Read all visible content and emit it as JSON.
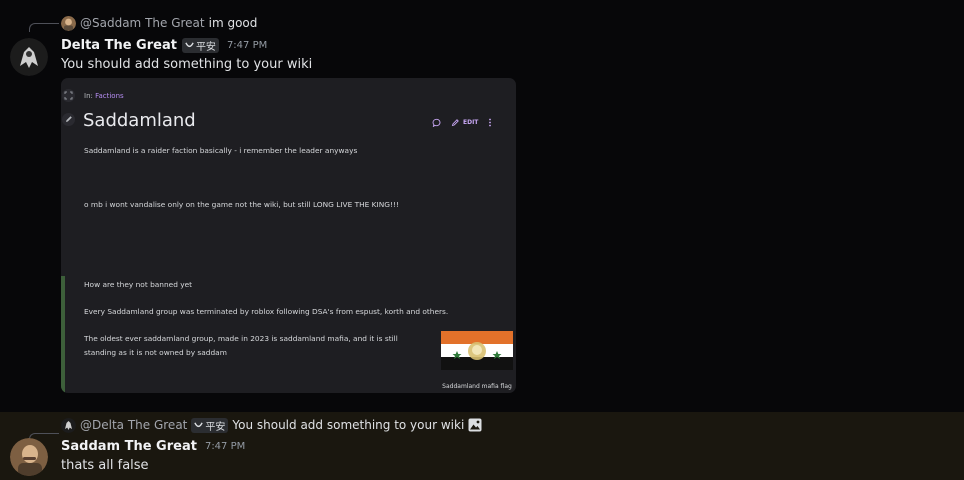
{
  "messages": [
    {
      "reply": {
        "mention": "@Saddam The Great",
        "text": "im good"
      },
      "author": "Delta The Great",
      "tag": "平安",
      "time": "7:47 PM",
      "content": "You should add something to your wiki",
      "attachment": {
        "breadcrumb_prefix": "In:",
        "breadcrumb_link": "Factions",
        "title": "Saddamland",
        "edit_label": "EDIT",
        "paragraphs": [
          "Saddamland is a raider faction basically - i remember the leader anyways",
          "o mb i wont vandalise only on the game not the wiki, but still LONG LIVE THE KING!!!",
          "How are they not banned yet",
          "Every Saddamland group was terminated by roblox following DSA's from espust, korth and others.",
          "The oldest ever saddamland group, made in 2023 is saddamland mafia, and it is still",
          "standing as it is not owned by saddam"
        ],
        "flag_caption": "Saddamland mafia flag",
        "flag_colors": [
          "#e2712a",
          "#ffffff",
          "#111111"
        ]
      }
    },
    {
      "reply": {
        "mention": "@Delta The Great",
        "tag": "平安",
        "text": "You should add something to your wiki"
      },
      "author": "Saddam The Great",
      "time": "7:47 PM",
      "content": "thats all false"
    }
  ],
  "colors": {
    "background": "#070709",
    "highlight": "#1a170f",
    "accent": "#b48cf0"
  },
  "icons": [
    "mini-avatar",
    "tag-icon",
    "image-icon",
    "fullscreen-icon",
    "pencil-icon",
    "comment-icon",
    "edit-pencil-icon",
    "more-icon"
  ]
}
